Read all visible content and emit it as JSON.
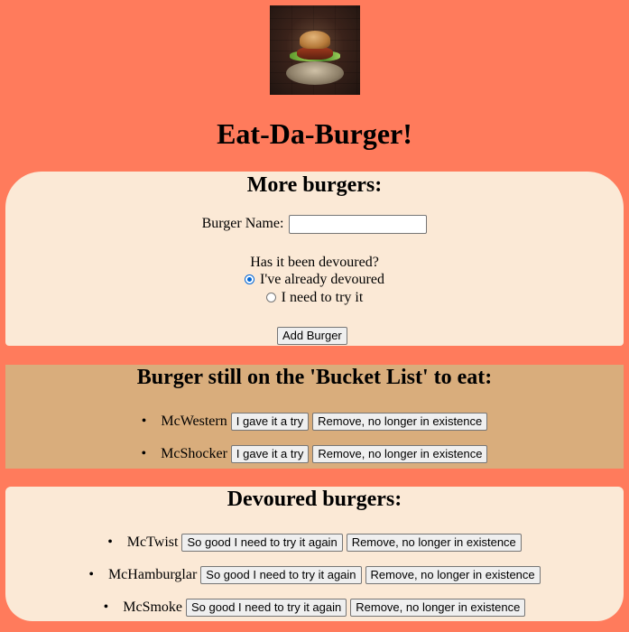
{
  "header": {
    "logo_icon": "burger-photo",
    "title": "Eat-Da-Burger!"
  },
  "add_form": {
    "heading": "More burgers:",
    "name_label": "Burger Name:",
    "name_value": "",
    "question": "Has it been devoured?",
    "options": [
      {
        "label": "I've already devoured",
        "checked": true
      },
      {
        "label": "I need to try it",
        "checked": false
      }
    ],
    "submit_label": "Add Burger"
  },
  "bucket_list": {
    "heading": "Burger still on the 'Bucket List' to eat:",
    "items": [
      {
        "name": "McWestern",
        "action_label": "I gave it a try",
        "remove_label": "Remove, no longer in existence"
      },
      {
        "name": "McShocker",
        "action_label": "I gave it a try",
        "remove_label": "Remove, no longer in existence"
      }
    ]
  },
  "devoured": {
    "heading": "Devoured burgers:",
    "items": [
      {
        "name": "McTwist",
        "action_label": "So good I need to try it again",
        "remove_label": "Remove, no longer in existence"
      },
      {
        "name": "McHamburglar",
        "action_label": "So good I need to try it again",
        "remove_label": "Remove, no longer in existence"
      },
      {
        "name": "McSmoke",
        "action_label": "So good I need to try it again",
        "remove_label": "Remove, no longer in existence"
      }
    ]
  },
  "colors": {
    "page_background": "#ff7b5c",
    "form_panel": "#fbe9d6",
    "bucket_panel": "#d9ad7c"
  }
}
